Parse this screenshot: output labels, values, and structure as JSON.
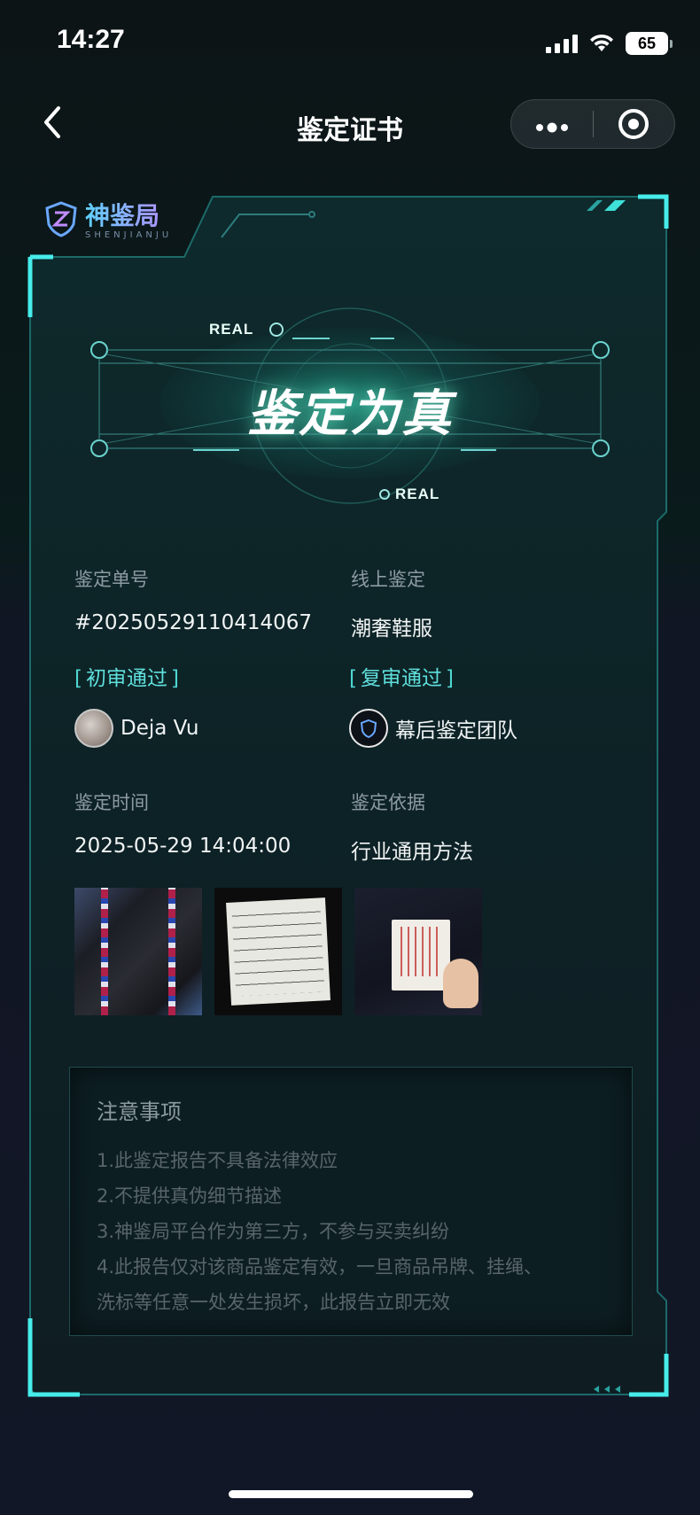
{
  "status_bar": {
    "time": "14:27",
    "battery": "65"
  },
  "nav": {
    "title": "鉴定证书",
    "more_icon": "more-dots-icon",
    "close_icon": "close-circle-icon"
  },
  "brand": {
    "name": "神鉴局",
    "sub": "SHENJIANJU"
  },
  "hero": {
    "title": "鉴定为真",
    "tag_top": "REAL",
    "tag_bottom": "REAL"
  },
  "details": {
    "order_label": "鉴定单号",
    "order_value": "#20250529110414067",
    "category_label": "线上鉴定",
    "category_value": "潮奢鞋服",
    "first_review": "初审通过",
    "first_reviewer": "Deja Vu",
    "second_review": "复审通过",
    "second_reviewer": "幕后鉴定团队",
    "time_label": "鉴定时间",
    "time_value": "2025-05-29 14:04:00",
    "basis_label": "鉴定依据",
    "basis_value": "行业通用方法"
  },
  "photos": [
    "jacket-photo",
    "care-label-photo",
    "champion-tag-photo"
  ],
  "notice": {
    "title": "注意事项",
    "items": [
      "1.此鉴定报告不具备法律效应",
      "2.不提供真伪细节描述",
      "3.神鉴局平台作为第三方，不参与买卖纠纷",
      "4.此报告仅对该商品鉴定有效，一旦商品吊牌、挂绳、",
      "洗标等任意一处发生损坏，此报告立即无效"
    ]
  },
  "colors": {
    "accent": "#3ee0d8",
    "frame": "#1e6e70",
    "background": "#121727"
  }
}
